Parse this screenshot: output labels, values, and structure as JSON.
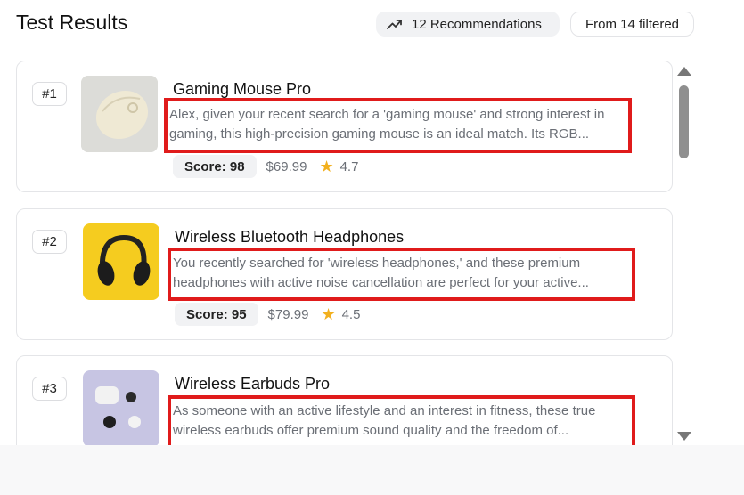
{
  "header": {
    "title": "Test Results",
    "recommendations_label": "12 Recommendations",
    "filtered_label": "From 14 filtered",
    "trend_icon": "trending-up-icon"
  },
  "colors": {
    "highlight_border": "#e01b1b",
    "star": "#f2b01e",
    "chip_bg": "#f1f2f4"
  },
  "results": [
    {
      "rank": "#1",
      "name": "Gaming Mouse Pro",
      "desc_line1": "Alex, given your recent search for a 'gaming mouse' and strong interest in",
      "desc_line2": "gaming, this high-precision gaming mouse is an ideal match. Its RGB...",
      "score": "Score: 98",
      "price": "$69.99",
      "rating": "4.7",
      "image": "white-gaming-mouse"
    },
    {
      "rank": "#2",
      "name": "Wireless Bluetooth Headphones",
      "desc_line1": "You recently searched for 'wireless headphones,' and these premium",
      "desc_line2": "headphones with active noise cancellation are perfect for your active...",
      "score": "Score: 95",
      "price": "$79.99",
      "rating": "4.5",
      "image": "black-headphones-on-yellow"
    },
    {
      "rank": "#3",
      "name": "Wireless Earbuds Pro",
      "desc_line1": "As someone with an active lifestyle and an interest in fitness, these true",
      "desc_line2": "wireless earbuds offer premium sound quality and the freedom of...",
      "image": "earbuds-on-lavender"
    }
  ]
}
